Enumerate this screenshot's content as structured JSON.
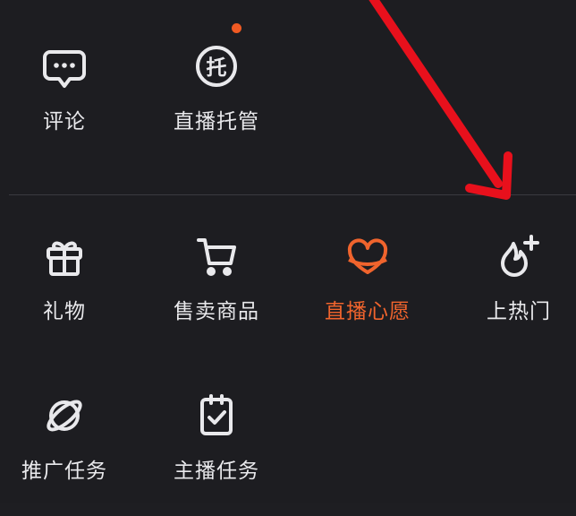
{
  "colors": {
    "background": "#1d1d21",
    "text": "#e9e9ec",
    "accent": "#f0642d",
    "annotation": "#e8101c"
  },
  "top_section": {
    "items": [
      {
        "label": "评论",
        "icon": "comment-bubble-icon"
      },
      {
        "label": "直播托管",
        "icon": "hosting-tuo-icon",
        "badge": "notification-dot"
      }
    ]
  },
  "bottom_section": {
    "items": [
      {
        "label": "礼物",
        "icon": "gift-icon"
      },
      {
        "label": "售卖商品",
        "icon": "shopping-cart-icon"
      },
      {
        "label": "直播心愿",
        "icon": "heart-wish-icon",
        "active": true
      },
      {
        "label": "上热门",
        "icon": "flame-plus-icon"
      },
      {
        "label": "推广任务",
        "icon": "planet-icon"
      },
      {
        "label": "主播任务",
        "icon": "task-clipboard-icon"
      }
    ]
  }
}
